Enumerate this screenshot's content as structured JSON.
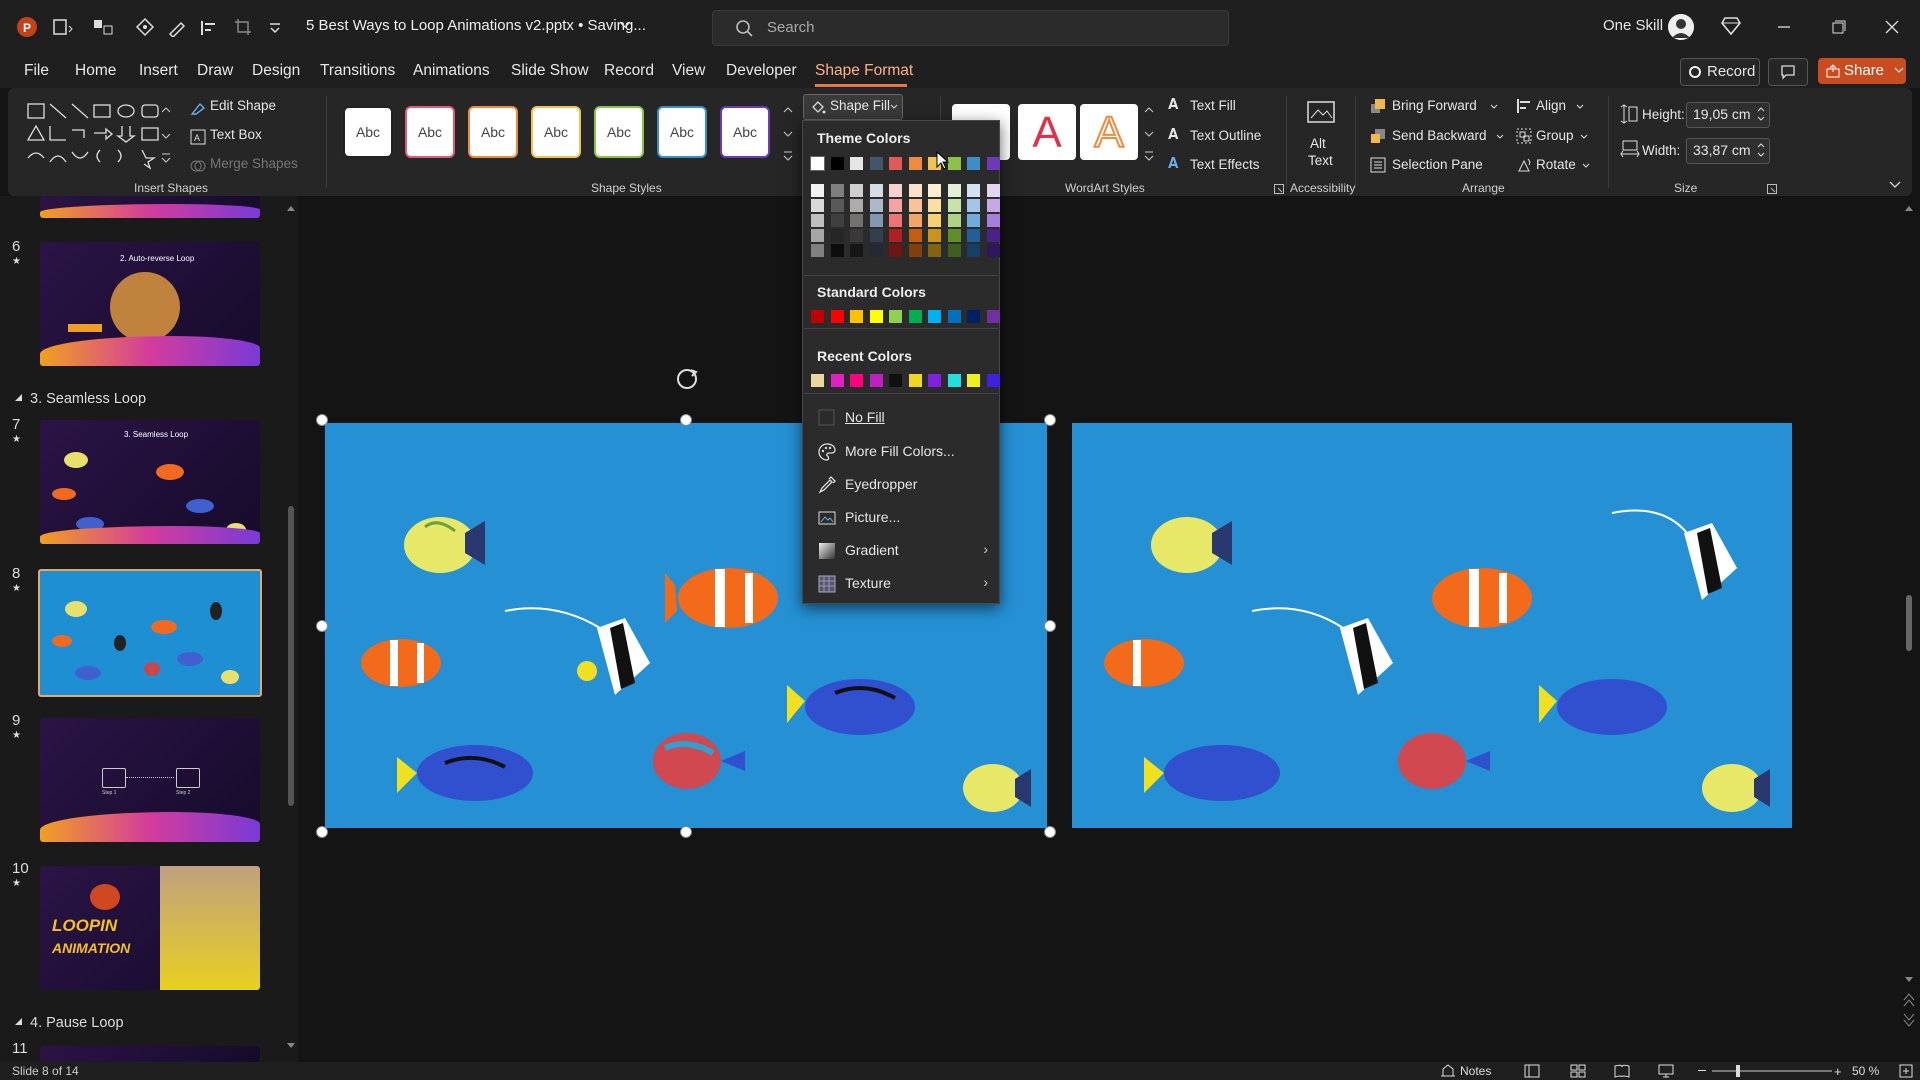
{
  "window": {
    "doc_title": "5 Best Ways to Loop Animations v2.pptx • Saving...",
    "search_placeholder": "Search",
    "user_name": "One Skill"
  },
  "menu": {
    "items": [
      "File",
      "Home",
      "Insert",
      "Draw",
      "Design",
      "Transitions",
      "Animations",
      "Slide Show",
      "Record",
      "View",
      "Developer",
      "Shape Format"
    ],
    "active": "Shape Format",
    "record_label": "Record",
    "share_label": "Share"
  },
  "ribbon": {
    "insert_shapes": {
      "edit_shape": "Edit Shape",
      "text_box": "Text Box",
      "merge_shapes": "Merge Shapes",
      "group_label": "Insert Shapes"
    },
    "shape_styles": {
      "sample_text": "Abc",
      "group_label": "Shape Styles",
      "shape_fill": "Shape Fill"
    },
    "wordart": {
      "text_fill": "Text Fill",
      "text_outline": "Text Outline",
      "text_effects": "Text Effects",
      "group_label": "WordArt Styles",
      "sample_letter": "A"
    },
    "accessibility": {
      "alt_text_line1": "Alt",
      "alt_text_line2": "Text",
      "group_label": "Accessibility"
    },
    "arrange": {
      "bring_forward": "Bring Forward",
      "send_backward": "Send Backward",
      "selection_pane": "Selection Pane",
      "align": "Align",
      "group": "Group",
      "rotate": "Rotate",
      "group_label": "Arrange"
    },
    "size": {
      "height_label": "Height:",
      "height_value": "19,05 cm",
      "width_label": "Width:",
      "width_value": "33,87 cm",
      "group_label": "Size"
    }
  },
  "slides_pane": {
    "slides": [
      {
        "num": "6",
        "title": "2. Auto-reverse Loop"
      },
      {
        "num": "7",
        "title": "3. Seamless Loop"
      },
      {
        "num": "8",
        "title": ""
      },
      {
        "num": "9",
        "step1": "Step 1",
        "step2": "Step 2"
      },
      {
        "num": "10",
        "badge": "LOOPIN",
        "badge2": "ANIMATION"
      },
      {
        "num": "11"
      }
    ],
    "sections": [
      "3. Seamless Loop",
      "4. Pause Loop"
    ]
  },
  "fill_menu": {
    "theme_colors_label": "Theme Colors",
    "standard_colors_label": "Standard Colors",
    "recent_colors_label": "Recent Colors",
    "no_fill": "No Fill",
    "more_fill_colors": "More Fill Colors...",
    "eyedropper": "Eyedropper",
    "picture": "Picture...",
    "gradient": "Gradient",
    "texture": "Texture",
    "theme_colors": [
      "#ffffff",
      "#000000",
      "#e7e6e6",
      "#44546a",
      "#e05a5a",
      "#f08a3e",
      "#f2c14e",
      "#8bc34a",
      "#3c8dc8",
      "#6a3ab8"
    ],
    "theme_shade_columns": [
      [
        "#f2f2f2",
        "#d9d9d9",
        "#bfbfbf",
        "#a6a6a6",
        "#808080"
      ],
      [
        "#7f7f7f",
        "#595959",
        "#3f3f3f",
        "#262626",
        "#0d0d0d"
      ],
      [
        "#d0cece",
        "#aeabab",
        "#757070",
        "#3a3838",
        "#171616"
      ],
      [
        "#d6dce4",
        "#adb9ca",
        "#8497b0",
        "#333f4f",
        "#222a35"
      ],
      [
        "#f9d0d0",
        "#f4a2a2",
        "#ee7373",
        "#b02020",
        "#701414"
      ],
      [
        "#fbe0cc",
        "#f8c29a",
        "#f4a467",
        "#c25f0f",
        "#813f0a"
      ],
      [
        "#fcefd0",
        "#f9e0a2",
        "#f6d073",
        "#c8941a",
        "#856211"
      ],
      [
        "#e3f0d5",
        "#c8e2ac",
        "#add483",
        "#5f8f2a",
        "#3f5f1c"
      ],
      [
        "#cfe3f3",
        "#a0c7e7",
        "#70abdb",
        "#205f97",
        "#153f64"
      ],
      [
        "#e2d4f3",
        "#c5a9e7",
        "#a87edb",
        "#4a218a",
        "#31165c"
      ]
    ],
    "standard_colors": [
      "#c00000",
      "#ff0000",
      "#ffc000",
      "#ffff00",
      "#92d050",
      "#00b050",
      "#00b0f0",
      "#0070c0",
      "#002060",
      "#7030a0"
    ],
    "recent_colors": [
      "#e8d8a0",
      "#e020c0",
      "#ff0080",
      "#c020c0",
      "#101010",
      "#f0d820",
      "#8020e0",
      "#20e0e0",
      "#f0f020",
      "#4020e0"
    ]
  },
  "status": {
    "slide_info": "Slide 8 of 14",
    "notes": "Notes",
    "zoom": "50 %"
  }
}
